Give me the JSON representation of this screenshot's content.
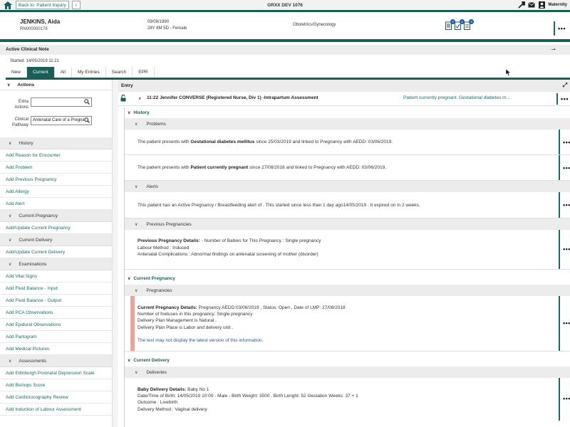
{
  "topbar": {
    "back_label": "Back to: Patient Inquiry",
    "app_title": "GRXX DEV 1076",
    "user_label": "Maternity",
    "icons": [
      "home-icon",
      "wrench-icon",
      "mail-icon",
      "user-icon"
    ]
  },
  "patient": {
    "name": "JENKINS, Aida",
    "mrn": "RN000000176",
    "dob": "09/09/1990",
    "age_sex": "28Y 8M 5D - Female",
    "specialty": "Obstetrics/Gynecology",
    "badges": [
      "3",
      "2",
      "3"
    ]
  },
  "note": {
    "title": "Active Clinical Note",
    "started": "Started: 14/05/2019   11:21"
  },
  "tabs": [
    "New",
    "Current",
    "All",
    "My Entries",
    "Search",
    "EPR"
  ],
  "active_tab": "Current",
  "actions": {
    "title": "Actions",
    "extra_actions_label": "Extra Actions",
    "extra_actions_value": "",
    "clinical_pathway_label": "Clinical Pathway",
    "clinical_pathway_value": "Antenatal Care of a Pregnant",
    "sections": [
      {
        "name": "History",
        "items": [
          "Add Reason for Encounter",
          "Add Problem",
          "Add Previous Pregnancy",
          "Add Allergy",
          "Add Alert"
        ]
      },
      {
        "name": "Current Pregnancy",
        "items": [
          "Add/Update Current Pregnancy"
        ]
      },
      {
        "name": "Current Delivery",
        "items": [
          "Add/Update Current Delivery"
        ]
      },
      {
        "name": "Examinations",
        "items": [
          "Add Vital Signs",
          "Add Fluid Balance - Input",
          "Add Fluid Balance - Output",
          "Add PCA Observations",
          "Add Epidural Observations",
          "Add Partogram",
          "Add Medical Pictures"
        ]
      },
      {
        "name": "Assessments",
        "items": [
          "Add Edinburgh Postnatal Depression Scale",
          "Add Bishops Score",
          "Add Cardiotocography Review",
          "Add Induction of Labour Assessment"
        ]
      }
    ]
  },
  "entry": {
    "title": "Entry",
    "row_text": "11:22 Jennifer CONVERSE (Registered Nurse, Div 1) -Intrapartum Assessment",
    "row_summary": "Patient currently pregnant, Gestational diabetes m...",
    "history_title": "History",
    "problems_title": "Problems",
    "problem1_pre": "The patient presents with ",
    "problem1_bold": "Gestational diabetes mellitus",
    "problem1_post": " since 25/03/2019 and linked to Pregnancy with AEDD: 03/06/2019.",
    "problem2_pre": "The patient presents with ",
    "problem2_bold": "Patient currently pregnant",
    "problem2_post": " since 27/08/2018 and linked to Pregnancy with AEDD: 03/06/2019.",
    "alerts_title": "Alerts",
    "alert_text": "This patient has an Active Pregnancy / Breastfeeding alert of . This started since  less than 1 day ago14/05/2019 . It expired on  in 2 weeks.",
    "prev_preg_title": "Previous Pregnancies",
    "prev_preg_bold": "Previous Pregnancy Details:",
    "prev_preg_line1": " - Number of Babies for This Pregnancy : Single pregnancy",
    "prev_preg_line2": "Labour Method : Induced",
    "prev_preg_line3": "Antenatal Complications : Abnormal findings on antenatal screening of mother (disorder)",
    "current_preg_title": "Current Pregnancy",
    "pregnancies_title": "Pregnancies",
    "cur_preg_bold": "Current Pregnancy Details:",
    "cur_preg_line1": " Pregnancy AEDD:03/06/2019 , Status: Open , Date of LMP: 27/08/2018",
    "cur_preg_line2": "Number of foetuses in this pregnancy: Single pregnancy",
    "cur_preg_line3": "Delivery Plan Management is Natural .",
    "cur_preg_line4": "Delivery Plan Place is Labor and delivery unit .",
    "cur_preg_link": "The text may not display the latest version of this information.",
    "current_delivery_title": "Current Delivery",
    "deliveries_title": "Deliveries",
    "baby_bold": "Baby Delivery Details:",
    "baby_line1": " Baby No 1",
    "baby_line2": "Date/Time of Birth: 14/05/2019 10:00 - Male - Birth Weight: 3500 , Birth Lenght: 52 Gestation Weeks: 37 + 1",
    "baby_line3": "Outcome : Livebirth",
    "baby_line4": "Delivery Method : Vaginal delivery"
  },
  "colors": {
    "accent": "#1b5e57",
    "link": "#1b6b63",
    "warning": "#e8a59c"
  }
}
